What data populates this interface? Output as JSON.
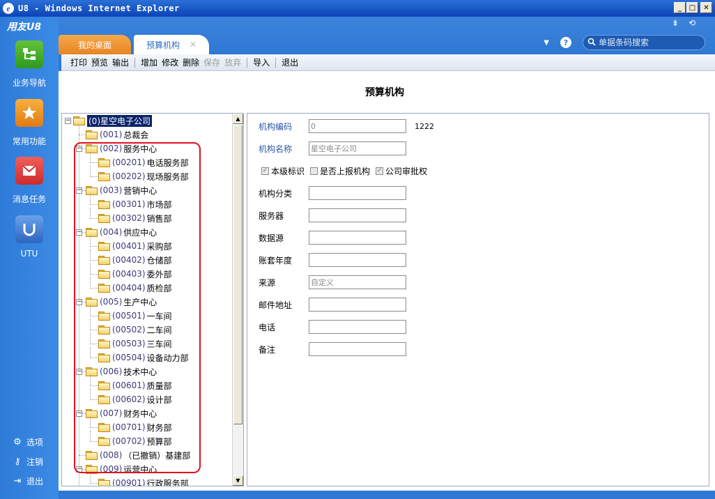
{
  "window": {
    "title": "U8 - Windows Internet Explorer"
  },
  "app": {
    "brand": "用友U8"
  },
  "leftnav": {
    "items": [
      {
        "label": "业务导航",
        "icon": "business-navigation-icon"
      },
      {
        "label": "常用功能",
        "icon": "star-icon"
      },
      {
        "label": "消息任务",
        "icon": "mail-icon"
      },
      {
        "label": "UTU",
        "icon": "utu-icon"
      }
    ],
    "bottom": [
      {
        "label": "选项",
        "icon": "gear-icon"
      },
      {
        "label": "注销",
        "icon": "key-icon"
      },
      {
        "label": "退出",
        "icon": "exit-icon"
      }
    ]
  },
  "tabs": [
    {
      "label": "我的桌面",
      "active": false
    },
    {
      "label": "预算机构",
      "active": true
    }
  ],
  "search": {
    "placeholder": "单据条码搜索"
  },
  "toolbar": {
    "items": [
      "打印",
      "预览",
      "输出",
      "增加",
      "修改",
      "删除",
      "保存",
      "放弃",
      "导入",
      "退出"
    ],
    "disabled": [
      "保存",
      "放弃"
    ]
  },
  "page": {
    "title": "预算机构"
  },
  "tree": {
    "root": {
      "code": "(0)",
      "name": "星空电子公司"
    },
    "nodes": [
      {
        "code": "(001)",
        "name": "总裁会",
        "level": 1,
        "expandable": false
      },
      {
        "code": "(002)",
        "name": "服务中心",
        "level": 1,
        "expandable": true
      },
      {
        "code": "(00201)",
        "name": "电话服务部",
        "level": 2
      },
      {
        "code": "(00202)",
        "name": "现场服务部",
        "level": 2
      },
      {
        "code": "(003)",
        "name": "营销中心",
        "level": 1,
        "expandable": true
      },
      {
        "code": "(00301)",
        "name": "市场部",
        "level": 2
      },
      {
        "code": "(00302)",
        "name": "销售部",
        "level": 2
      },
      {
        "code": "(004)",
        "name": "供应中心",
        "level": 1,
        "expandable": true
      },
      {
        "code": "(00401)",
        "name": "采购部",
        "level": 2
      },
      {
        "code": "(00402)",
        "name": "仓储部",
        "level": 2
      },
      {
        "code": "(00403)",
        "name": "委外部",
        "level": 2
      },
      {
        "code": "(00404)",
        "name": "质检部",
        "level": 2
      },
      {
        "code": "(005)",
        "name": "生产中心",
        "level": 1,
        "expandable": true
      },
      {
        "code": "(00501)",
        "name": "一车间",
        "level": 2
      },
      {
        "code": "(00502)",
        "name": "二车间",
        "level": 2
      },
      {
        "code": "(00503)",
        "name": "三车间",
        "level": 2
      },
      {
        "code": "(00504)",
        "name": "设备动力部",
        "level": 2
      },
      {
        "code": "(006)",
        "name": "技术中心",
        "level": 1,
        "expandable": true
      },
      {
        "code": "(00601)",
        "name": "质量部",
        "level": 2
      },
      {
        "code": "(00602)",
        "name": "设计部",
        "level": 2
      },
      {
        "code": "(007)",
        "name": "财务中心",
        "level": 1,
        "expandable": true
      },
      {
        "code": "(00701)",
        "name": "财务部",
        "level": 2
      },
      {
        "code": "(00702)",
        "name": "预算部",
        "level": 2
      },
      {
        "code": "(008)",
        "name": "（已撤销）基建部",
        "level": 1,
        "expandable": false
      },
      {
        "code": "(009)",
        "name": "运营中心",
        "level": 1,
        "expandable": true
      },
      {
        "code": "(00901)",
        "name": "行政服务部",
        "level": 2
      }
    ]
  },
  "form": {
    "fields": [
      {
        "label": "机构编码",
        "value": "0",
        "extra": "1222",
        "blue": true
      },
      {
        "label": "机构名称",
        "value": "星空电子公司",
        "blue": true
      }
    ],
    "checkboxes": [
      {
        "label": "本级标识",
        "checked": true
      },
      {
        "label": "是否上报机构",
        "checked": false
      },
      {
        "label": "公司审批权",
        "checked": true
      }
    ],
    "fields2": [
      {
        "label": "机构分类",
        "value": ""
      },
      {
        "label": "服务器",
        "value": ""
      },
      {
        "label": "数据源",
        "value": ""
      },
      {
        "label": "账套年度",
        "value": ""
      },
      {
        "label": "来源",
        "value": "自定义"
      },
      {
        "label": "邮件地址",
        "value": ""
      },
      {
        "label": "电话",
        "value": ""
      },
      {
        "label": "备注",
        "value": ""
      }
    ]
  }
}
